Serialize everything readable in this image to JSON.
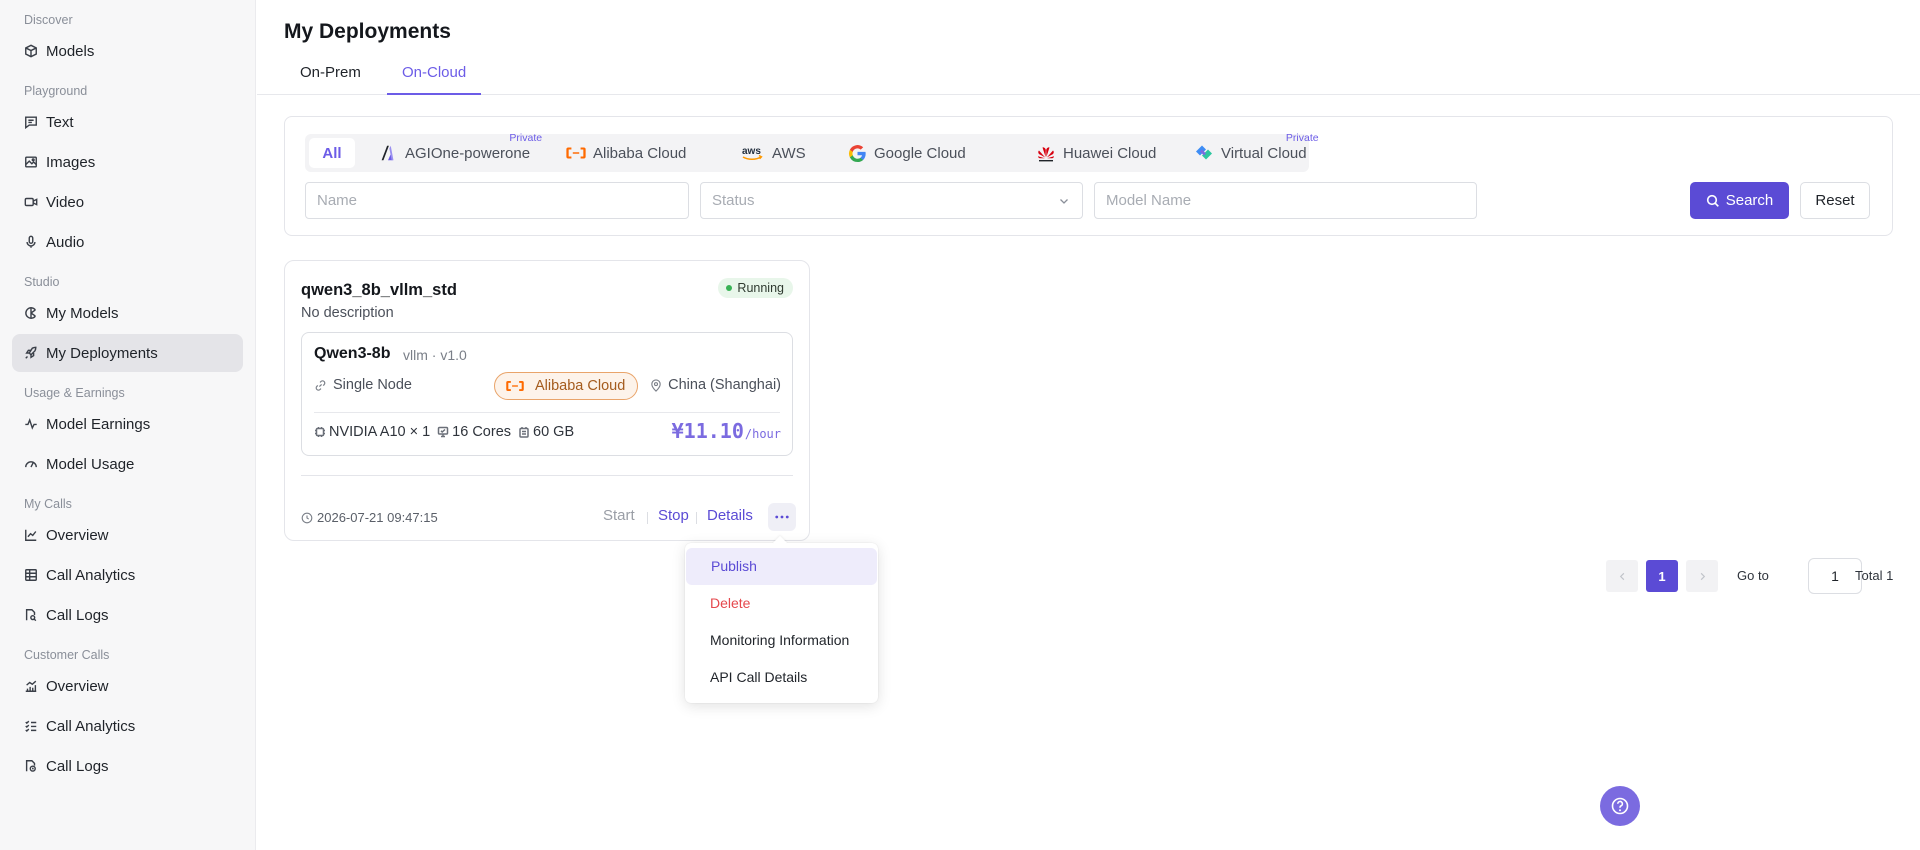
{
  "sidebar": {
    "discover": "Discover",
    "models": "Models",
    "playground": "Playground",
    "text": "Text",
    "images": "Images",
    "video": "Video",
    "audio": "Audio",
    "studio": "Studio",
    "my_models": "My Models",
    "my_deployments": "My Deployments",
    "usage_earnings": "Usage & Earnings",
    "model_earnings": "Model Earnings",
    "model_usage": "Model Usage",
    "my_calls": "My Calls",
    "mc_overview": "Overview",
    "mc_call_analytics": "Call Analytics",
    "mc_call_logs": "Call Logs",
    "customer_calls": "Customer Calls",
    "cc_overview": "Overview",
    "cc_call_analytics": "Call Analytics",
    "cc_call_logs": "Call Logs"
  },
  "page": {
    "title": "My Deployments"
  },
  "tabs": {
    "on_prem": "On-Prem",
    "on_cloud": "On-Cloud"
  },
  "providers": {
    "all": "All",
    "agione": "AGIOne-powerone",
    "alibaba": "Alibaba Cloud",
    "aws": "AWS",
    "google": "Google Cloud",
    "huawei": "Huawei Cloud",
    "virtual": "Virtual Cloud",
    "private_tag": "Private",
    "aws_logo_text": "aws"
  },
  "filters": {
    "name_placeholder": "Name",
    "status_placeholder": "Status",
    "model_name_placeholder": "Model Name",
    "search": "Search",
    "reset": "Reset"
  },
  "card": {
    "title": "qwen3_8b_vllm_std",
    "description": "No description",
    "status": "Running",
    "model": "Qwen3-8b",
    "version": "vllm · v1.0",
    "node": "Single Node",
    "cloud": "Alibaba Cloud",
    "region": "China (Shanghai)",
    "gpu": "NVIDIA A10 × 1",
    "cores": "16 Cores",
    "memory": "60 GB",
    "price": "¥11.10",
    "price_unit": "/hour",
    "timestamp": "2026-07-21 09:47:15",
    "start": "Start",
    "stop": "Stop",
    "details": "Details"
  },
  "menu": {
    "publish": "Publish",
    "delete": "Delete",
    "monitoring": "Monitoring Information",
    "api_call": "API Call Details"
  },
  "pagination": {
    "current": "1",
    "goto_label": "Go to",
    "goto_value": "1",
    "total": "Total 1"
  },
  "colors": {
    "accent": "#5b4bd5",
    "running": "#38b255",
    "danger": "#e5484d",
    "alibaba": "#ff6a00"
  }
}
